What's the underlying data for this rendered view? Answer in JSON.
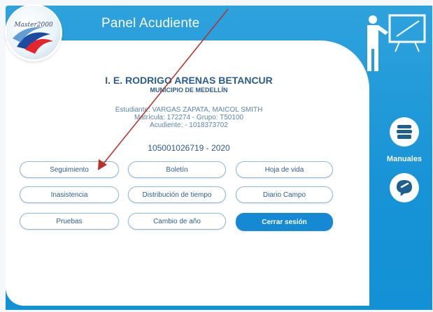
{
  "header": {
    "title": "Panel Acudiente",
    "logo_text": "Master2000"
  },
  "institution": {
    "name": "I. E. RODRIGO ARENAS BETANCUR",
    "municipality": "MUNICIPIO DE MEDELLÍN"
  },
  "student": {
    "line1": "Estudiante: VARGAS ZAPATA, MAICOL SMITH",
    "line2": "Matrícula: 172274 - Grupo: T50100",
    "line3": "Acudiente: - 1018373702"
  },
  "code": "105001026719 - 2020",
  "buttons": {
    "seguimiento": "Seguimiento",
    "boletin": "Boletín",
    "hoja_vida": "Hoja de vida",
    "inasistencia": "Inasistencia",
    "distribucion": "Distribución de tiempo",
    "diario": "Diario Campo",
    "pruebas": "Pruebas",
    "cambio_anio": "Cambio de año",
    "cerrar": "Cerrar sesión"
  },
  "sidebar": {
    "manuales": "Manuales",
    "blog": "Blog"
  },
  "colors": {
    "brand_blue": "#1793d6",
    "button_border": "#8fb9d8",
    "primary_button": "#1589d3",
    "annotation_arrow": "#b5322a"
  }
}
